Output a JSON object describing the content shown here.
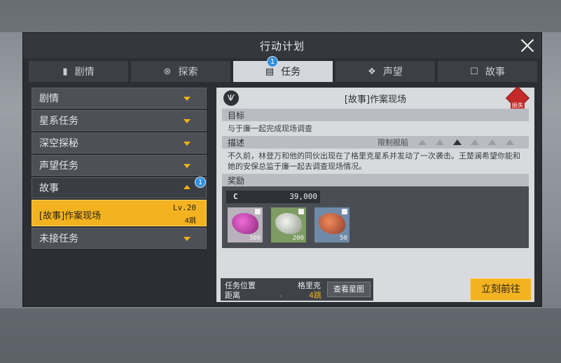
{
  "window": {
    "title": "行动计划"
  },
  "tabs": [
    {
      "label": "剧情",
      "icon": "book-icon"
    },
    {
      "label": "探索",
      "icon": "explore-icon"
    },
    {
      "label": "任务",
      "icon": "clipboard-icon",
      "active": true,
      "badge": "1"
    },
    {
      "label": "声望",
      "icon": "emblem-icon"
    },
    {
      "label": "故事",
      "icon": "story-icon"
    }
  ],
  "sidebar": {
    "items": [
      {
        "label": "剧情"
      },
      {
        "label": "星系任务"
      },
      {
        "label": "深空探秘"
      },
      {
        "label": "声望任务"
      },
      {
        "label": "故事",
        "badge": "1"
      },
      {
        "label": "未接任务"
      }
    ],
    "selected": {
      "name": "[故事]作案现场",
      "level": "Lv.20",
      "distance": "4跳"
    }
  },
  "detail": {
    "title": "[故事]作案现场",
    "loss_label": "损失",
    "objective_header": "目标",
    "objective": "与于廉一起完成现场调查",
    "description_header": "描述",
    "ship_limit_label": "限制舰船",
    "description": "不久前，林登万和他的同伙出现在了格里克星系并发动了一次袭击。王楚澜希望你能和她的安保总监于廉一起去调查现场情况。",
    "reward_header": "奖励",
    "credit_symbol": "C",
    "credit_amount": "39,000",
    "rewards": [
      {
        "qty": "300",
        "color": "purple"
      },
      {
        "qty": "200",
        "color": "green"
      },
      {
        "qty": "50",
        "color": "orange"
      }
    ],
    "location_label": "任务位置",
    "location_value": "格里克",
    "distance_label": "距离",
    "distance_value": "4跳",
    "distance_dot": ".",
    "view_map": "查看星图",
    "go_button": "立刻前往"
  },
  "colors": {
    "accent": "#f3b320",
    "badge": "#2f8fe0",
    "loss": "#c52a2a"
  }
}
